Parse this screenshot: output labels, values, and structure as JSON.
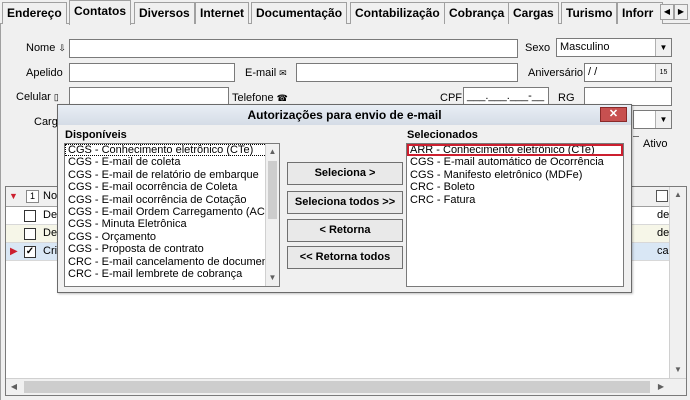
{
  "tabs": [
    "Endereço",
    "Contatos",
    "Diversos",
    "Internet",
    "Documentação",
    "Contabilização",
    "Cobrança",
    "Cargas",
    "Turismo",
    "Inforr"
  ],
  "active_tab": "Contatos",
  "form": {
    "nome_label": "Nome",
    "sexo_label": "Sexo",
    "sexo_value": "Masculino",
    "apelido_label": "Apelido",
    "email_label": "E-mail",
    "aniversario_label": "Aniversário",
    "aniversario_value": " / /",
    "celular_label": "Celular",
    "telefone_label": "Telefone",
    "cpf_label": "CPF",
    "cpf_value": "___.___.___-__",
    "rg_label": "RG",
    "cargo_label": "Carg",
    "ativo_label": "Ativo"
  },
  "grid": {
    "header_col": "No",
    "rows": [
      {
        "name": "De",
        "right": "de",
        "checked": false,
        "current": false
      },
      {
        "name": "De",
        "right": "de",
        "checked": false,
        "current": false
      },
      {
        "name": "Cri",
        "right": "ca",
        "checked": true,
        "current": true
      }
    ]
  },
  "dialog": {
    "title": "Autorizações para envio de e-mail",
    "close_label": "✕",
    "available_label": "Disponíveis",
    "selected_label": "Selecionados",
    "available": [
      "CGS - Conhecimento eletrônico (CTe)",
      "CGS - E-mail de coleta",
      "CGS - E-mail de relatório de embarque",
      "CGS - E-mail ocorrência de Coleta",
      "CGS - E-mail ocorrência de Cotação",
      "CGS - E-mail Ordem Carregamento (ACT)",
      "CGS - Minuta Eletrônica",
      "CGS - Orçamento",
      "CGS - Proposta de contrato",
      "CRC - E-mail cancelamento de documento",
      "CRC - E-mail lembrete de cobrança"
    ],
    "selected": [
      "ARR - Conhecimento eletrônico (CTe)",
      "CGS - E-mail automático de Ocorrência",
      "CGS - Manifesto eletrônico (MDFe)",
      "CRC - Boleto",
      "CRC - Fatura"
    ],
    "buttons": {
      "select": "Seleciona >",
      "select_all": "Seleciona todos >>",
      "return": "< Retorna",
      "return_all": "<< Retorna todos"
    }
  },
  "colors": {
    "title_bar": "#d5dce6",
    "close_button": "#c75050",
    "highlight_border": "#cc1f2f",
    "grid_selected_row": "#d9e7f5"
  }
}
